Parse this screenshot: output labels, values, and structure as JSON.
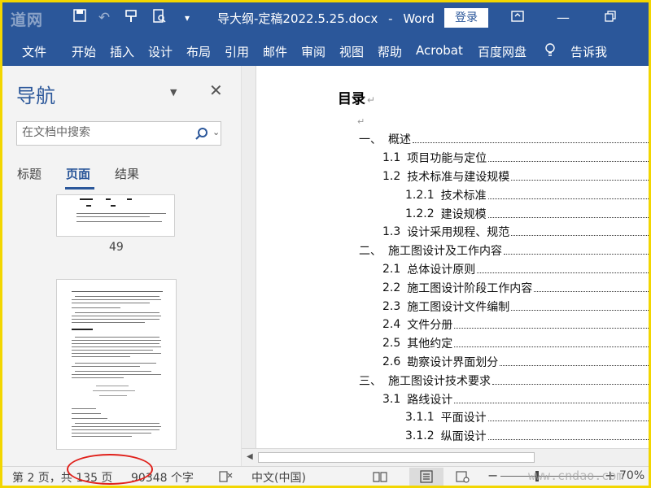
{
  "title_bar": {
    "watermark": "道网",
    "doc_title": "导大纲-定稿2022.5.25.docx",
    "app_name": "Word",
    "login_label": "登录",
    "icons": [
      "save-icon",
      "undo-icon",
      "redo-icon",
      "format-painter-icon",
      "print-preview-icon",
      "customize-qat-icon",
      "ribbon-display-icon",
      "minimize-icon",
      "maximize-icon"
    ]
  },
  "ribbon": {
    "tabs": [
      "文件",
      "开始",
      "插入",
      "设计",
      "布局",
      "引用",
      "邮件",
      "审阅",
      "视图",
      "帮助",
      "Acrobat",
      "百度网盘"
    ],
    "tell_me": "告诉我"
  },
  "nav_pane": {
    "title": "导航",
    "search_placeholder": "在文档中搜索",
    "tabs": [
      "标题",
      "页面",
      "结果"
    ],
    "active_tab": "页面",
    "page_labels": [
      "49"
    ]
  },
  "document": {
    "toc_heading": "目录",
    "toc": [
      {
        "num": "一、",
        "text": "概述"
      },
      {
        "num": "1.1",
        "text": "项目功能与定位"
      },
      {
        "num": "1.2",
        "text": "技术标准与建设规模"
      },
      {
        "num": "1.2.1",
        "text": "技术标准"
      },
      {
        "num": "1.2.2",
        "text": "建设规模"
      },
      {
        "num": "1.3",
        "text": "设计采用规程、规范"
      },
      {
        "num": "二、",
        "text": "施工图设计及工作内容"
      },
      {
        "num": "2.1",
        "text": "总体设计原则"
      },
      {
        "num": "2.2",
        "text": "施工图设计阶段工作内容"
      },
      {
        "num": "2.3",
        "text": "施工图设计文件编制"
      },
      {
        "num": "2.4",
        "text": "文件分册"
      },
      {
        "num": "2.5",
        "text": "其他约定"
      },
      {
        "num": "2.6",
        "text": "勘察设计界面划分"
      },
      {
        "num": "三、",
        "text": "施工图设计技术要求"
      },
      {
        "num": "3.1",
        "text": "路线设计"
      },
      {
        "num": "3.1.1",
        "text": "平面设计"
      },
      {
        "num": "3.1.2",
        "text": "纵面设计"
      }
    ]
  },
  "status_bar": {
    "page_info": "第 2 页，共 135 页",
    "word_count": "90348 个字",
    "language": "中文(中国)",
    "zoom": "70%",
    "site_watermark": "www.cndao.com"
  },
  "colors": {
    "word_blue": "#2b579a",
    "frame_yellow": "#f2d600",
    "annotation_red": "#e0201a"
  }
}
